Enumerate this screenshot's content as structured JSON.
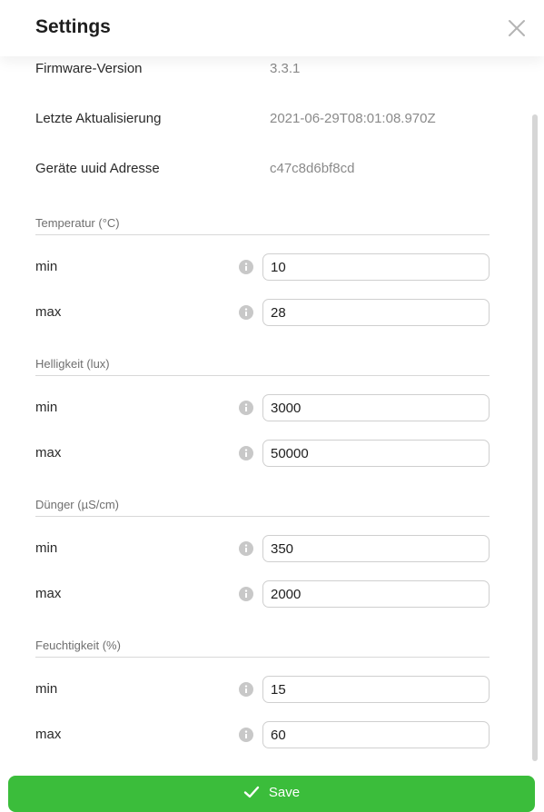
{
  "dialog": {
    "title": "Settings",
    "close_icon": "close-icon"
  },
  "info": [
    {
      "label": "Firmware-Version",
      "value": "3.3.1"
    },
    {
      "label": "Letzte Aktualisierung",
      "value": "2021-06-29T08:01:08.970Z"
    },
    {
      "label": "Geräte uuid Adresse",
      "value": "c47c8d6bf8cd"
    }
  ],
  "sections": [
    {
      "title": "Temperatur (°C)",
      "fields": [
        {
          "label": "min",
          "value": "10"
        },
        {
          "label": "max",
          "value": "28"
        }
      ]
    },
    {
      "title": "Helligkeit (lux)",
      "fields": [
        {
          "label": "min",
          "value": "3000"
        },
        {
          "label": "max",
          "value": "50000"
        }
      ]
    },
    {
      "title": "Dünger (µS/cm)",
      "fields": [
        {
          "label": "min",
          "value": "350"
        },
        {
          "label": "max",
          "value": "2000"
        }
      ]
    },
    {
      "title": "Feuchtigkeit (%)",
      "fields": [
        {
          "label": "min",
          "value": "15"
        },
        {
          "label": "max",
          "value": "60"
        }
      ]
    }
  ],
  "save_button": {
    "label": "Save",
    "icon": "checkmark-icon",
    "color": "#3bbd3b"
  },
  "colors": {
    "accent": "#3bbd3b",
    "info_icon": "#c8c8c8"
  }
}
